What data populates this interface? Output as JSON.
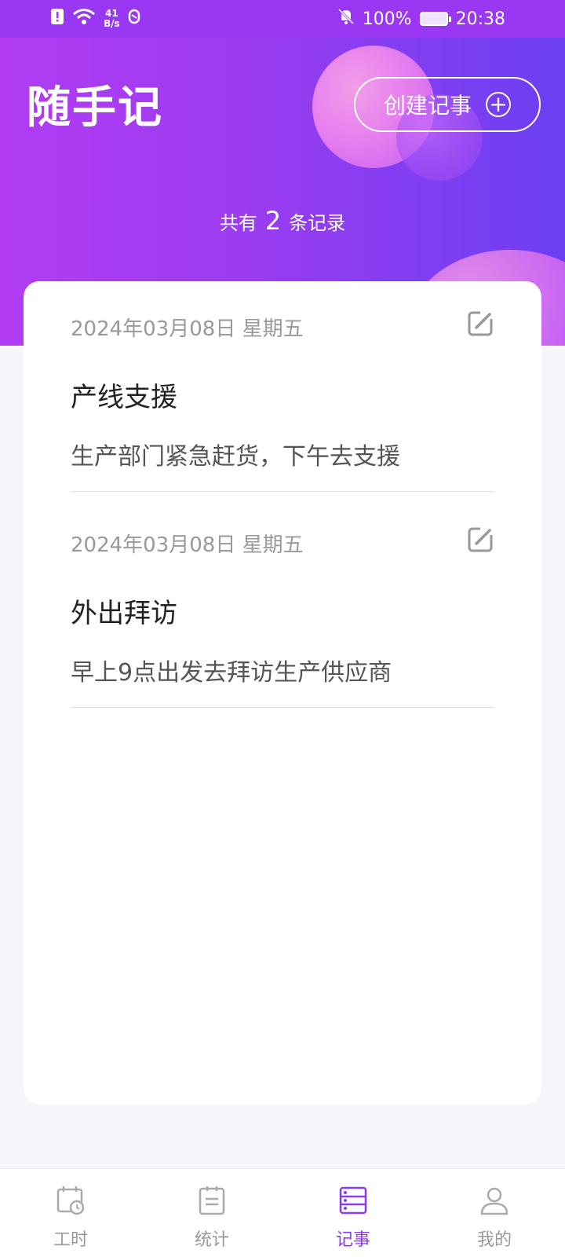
{
  "status_bar": {
    "speed_value": "41",
    "speed_unit": "B/s",
    "battery": "100%",
    "time": "20:38"
  },
  "header": {
    "title": "随手记",
    "create_button": "创建记事",
    "summary_prefix": "共有",
    "summary_count": "2",
    "summary_suffix": "条记录"
  },
  "notes": [
    {
      "date": "2024年03月08日 星期五",
      "title": "产线支援",
      "body": "生产部门紧急赶货，下午去支援"
    },
    {
      "date": "2024年03月08日 星期五",
      "title": "外出拜访",
      "body": "早上9点出发去拜访生产供应商"
    }
  ],
  "bottom_nav": {
    "items": [
      {
        "label": "工时",
        "icon": "calendar-clock-icon"
      },
      {
        "label": "统计",
        "icon": "clipboard-list-icon"
      },
      {
        "label": "记事",
        "icon": "server-stack-icon"
      },
      {
        "label": "我的",
        "icon": "person-icon"
      }
    ],
    "active_index": 2
  },
  "colors": {
    "accent": "#8a3cf0",
    "header_gradient_start": "#b23cf3",
    "header_gradient_end": "#6b3ff2"
  }
}
